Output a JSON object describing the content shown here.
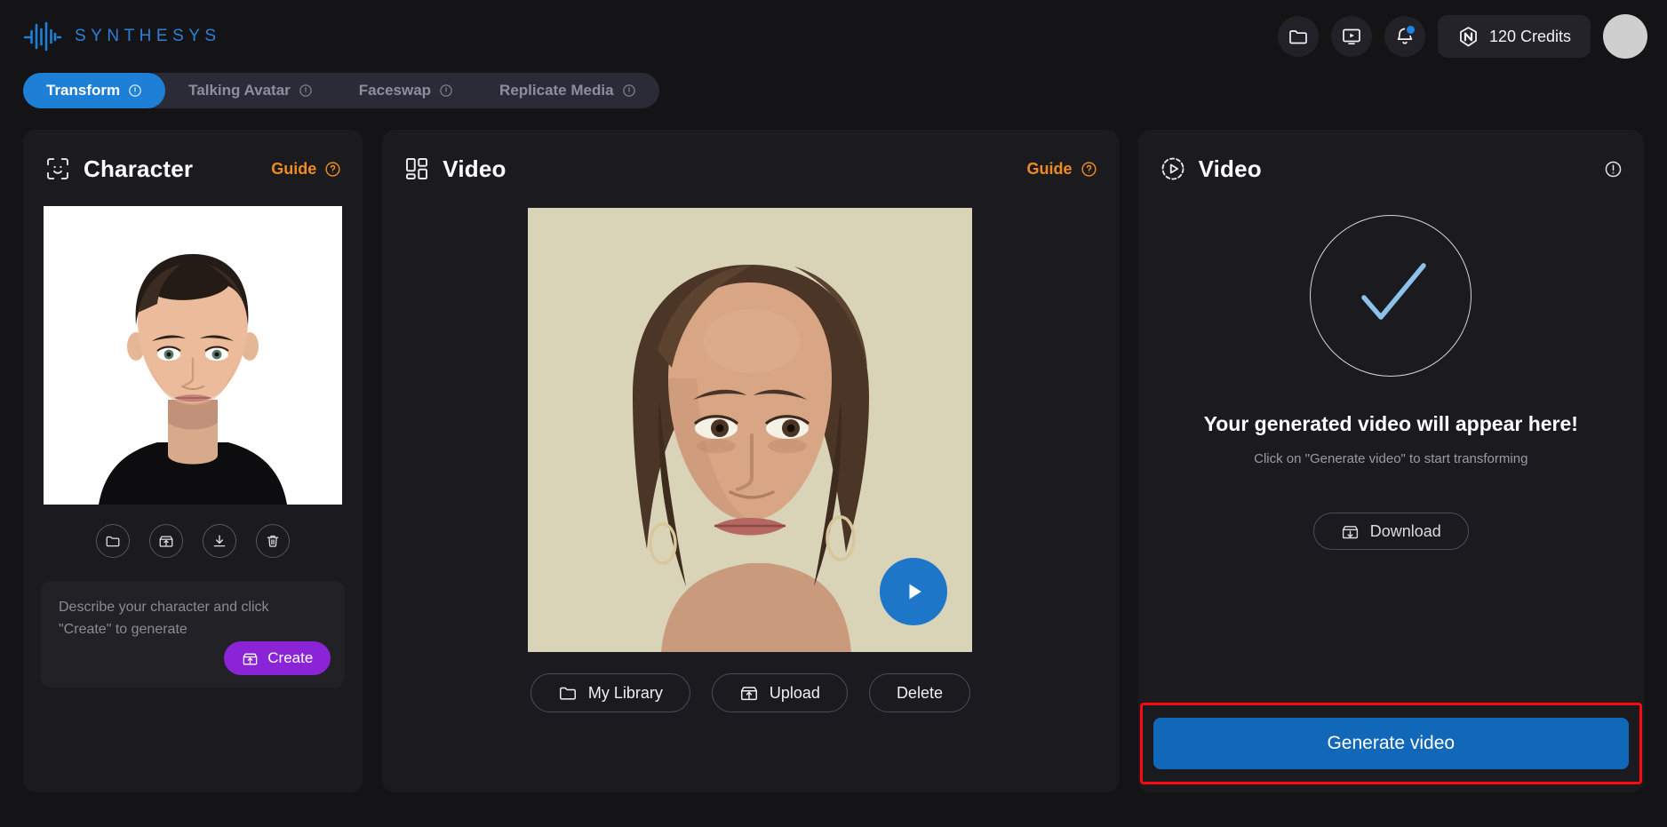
{
  "header": {
    "brand": "SYNTHESYS",
    "logo_icon": "waveform-icon",
    "folder_icon": "folder-icon",
    "media_icon": "video-monitor-icon",
    "bell_icon": "bell-icon",
    "credits_icon": "synthesys-token-icon",
    "credits_label": "120 Credits",
    "avatar_icon": "avatar"
  },
  "tabs": [
    {
      "label": "Transform",
      "active": true,
      "info_icon": "info-icon"
    },
    {
      "label": "Talking Avatar",
      "active": false,
      "info_icon": "info-icon"
    },
    {
      "label": "Faceswap",
      "active": false,
      "info_icon": "info-icon"
    },
    {
      "label": "Replicate Media",
      "active": false,
      "info_icon": "info-icon"
    }
  ],
  "character_panel": {
    "icon": "face-scan-icon",
    "title": "Character",
    "guide_label": "Guide",
    "guide_help_icon": "question-circle-icon",
    "image_alt": "young man with dark hair wearing a black shirt on white background",
    "tools": [
      {
        "name": "library-folder",
        "icon": "folder-icon"
      },
      {
        "name": "upload",
        "icon": "upload-box-icon"
      },
      {
        "name": "download",
        "icon": "download-icon"
      },
      {
        "name": "delete",
        "icon": "trash-icon"
      }
    ],
    "prompt_placeholder": "Describe your character and click \"Create\" to generate",
    "create_label": "Create",
    "create_icon": "upload-box-icon"
  },
  "video_panel": {
    "icon": "layout-grid-icon",
    "title": "Video",
    "guide_label": "Guide",
    "guide_help_icon": "question-circle-icon",
    "thumbnail_alt": "woman with long brown hair and hoop earrings against a beige wall",
    "play_icon": "play-icon",
    "actions": [
      {
        "label": "My Library",
        "icon": "folder-icon"
      },
      {
        "label": "Upload",
        "icon": "upload-box-icon"
      },
      {
        "label": "Delete",
        "icon": "none"
      }
    ]
  },
  "output_panel": {
    "icon": "play-circle-icon",
    "title": "Video",
    "info_icon": "exclamation-circle-icon",
    "status_icon": "check-circle-icon",
    "empty_title": "Your generated video will appear here!",
    "empty_subtitle": "Click on \"Generate video\" to start transforming",
    "download_label": "Download",
    "download_icon": "download-box-icon",
    "generate_label": "Generate video"
  },
  "colors": {
    "page_bg": "#141417",
    "card_bg": "#1b1b1f",
    "accent_blue": "#1e7fd6",
    "generate_blue": "#1268b8",
    "guide_orange": "#ef8b20",
    "create_purple": "#8b23d6",
    "highlight_red": "#fb0a12",
    "brand_blue": "#2f7fd4"
  }
}
